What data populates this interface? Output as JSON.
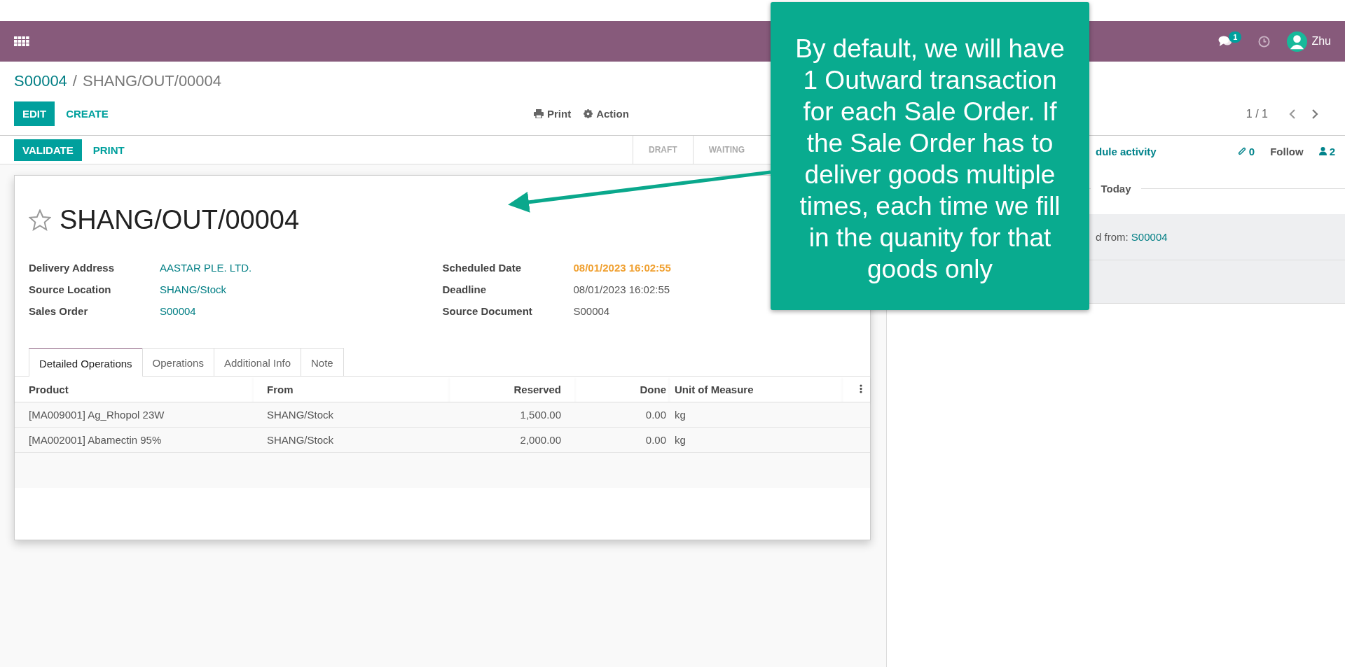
{
  "navbar": {
    "messages_badge": "1",
    "user_name": "Zhu"
  },
  "breadcrumb": {
    "parent": "S00004",
    "separator": "/",
    "current": "SHANG/OUT/00004"
  },
  "control_panel": {
    "buttons": [
      {
        "label": "EDIT",
        "kind": "primary"
      },
      {
        "label": "CREATE",
        "kind": "link"
      }
    ],
    "actions": [
      {
        "label": "Print",
        "kind": "print"
      },
      {
        "label": "Action",
        "kind": "gear"
      }
    ],
    "pager": "1 / 1"
  },
  "statusbar": {
    "buttons": [
      {
        "label": "VALIDATE",
        "kind": "primary"
      },
      {
        "label": "PRINT",
        "kind": "link"
      }
    ],
    "stages": [
      {
        "label": "DRAFT",
        "selected": false
      },
      {
        "label": "WAITING",
        "selected": false
      }
    ]
  },
  "form": {
    "title": "SHANG/OUT/00004",
    "starred": false,
    "fields_left": [
      {
        "label": "Delivery Address",
        "value": "AASTAR PLE. LTD.",
        "kind": "link"
      },
      {
        "label": "Source Location",
        "value": "SHANG/Stock",
        "kind": "link"
      },
      {
        "label": "Sales Order",
        "value": "S00004",
        "kind": "link"
      }
    ],
    "fields_right": [
      {
        "label": "Scheduled Date",
        "value": "08/01/2023 16:02:55",
        "kind": "warning"
      },
      {
        "label": "Deadline",
        "value": "08/01/2023 16:02:55",
        "kind": "plain"
      },
      {
        "label": "Source Document",
        "value": "S00004",
        "kind": "plain"
      }
    ],
    "tabs": [
      {
        "label": "Detailed Operations",
        "selected": true
      },
      {
        "label": "Operations",
        "selected": false
      },
      {
        "label": "Additional Info",
        "selected": false
      },
      {
        "label": "Note",
        "selected": false
      }
    ],
    "table": {
      "columns": [
        "Product",
        "From",
        "Reserved",
        "Done",
        "Unit of Measure"
      ],
      "rows": [
        [
          "[MA009001] Ag_Rhopol 23W",
          "SHANG/Stock",
          "1,500.00",
          "0.00",
          "kg"
        ],
        [
          "[MA002001] Abamectin 95%",
          "SHANG/Stock",
          "2,000.00",
          "0.00",
          "kg"
        ]
      ]
    }
  },
  "chatter": {
    "activity_link": "dule activity",
    "attachments": "0",
    "follow": "Follow",
    "followers": "2",
    "date_separator": "Today",
    "message": {
      "text": "d from: ",
      "link": "S00004"
    }
  },
  "callout": {
    "text": "By default, we will have 1 Outward transaction for each Sale Order. If the Sale Order has to deliver goods multiple times, each time we fill in the quanity for that goods only"
  }
}
